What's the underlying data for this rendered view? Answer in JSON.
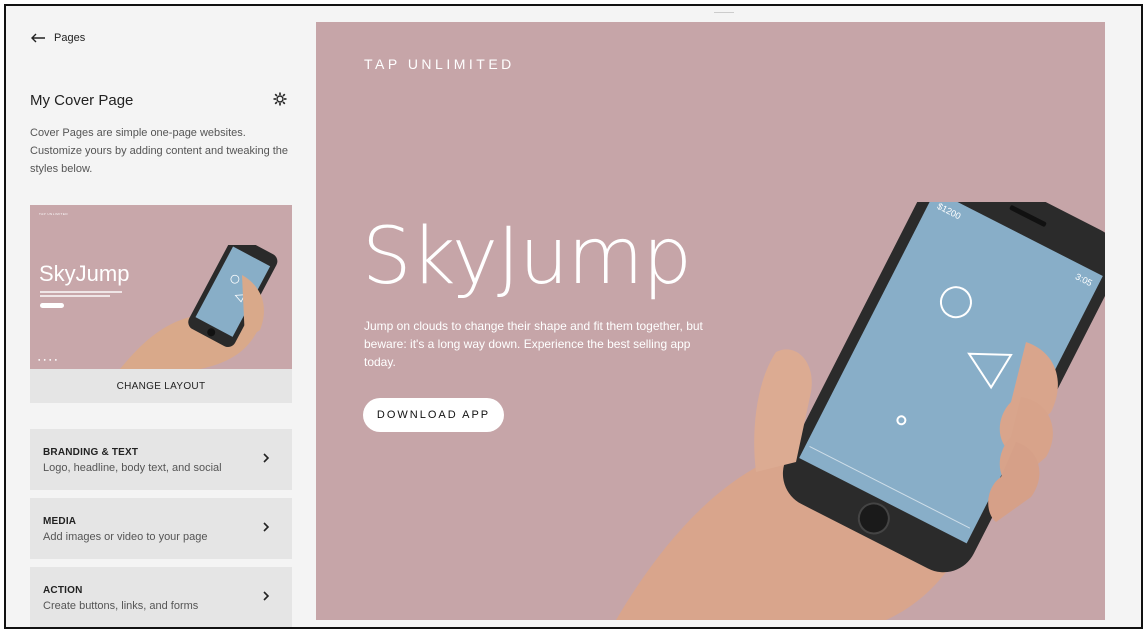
{
  "sidebar": {
    "back_label": "Pages",
    "page_title": "My Cover Page",
    "description": "Cover Pages are simple one-page websites. Customize yours by adding content and tweaking the styles below.",
    "thumbnail": {
      "brand": "TAP UNLIMITED",
      "headline": "SkyJump",
      "button": "DOWNLOAD APP"
    },
    "change_layout_label": "CHANGE LAYOUT",
    "panels": [
      {
        "title": "BRANDING & TEXT",
        "subtitle": "Logo, headline, body text, and social"
      },
      {
        "title": "MEDIA",
        "subtitle": "Add images or video to your page"
      },
      {
        "title": "ACTION",
        "subtitle": "Create buttons, links, and forms"
      }
    ]
  },
  "preview": {
    "brand": "TAP UNLIMITED",
    "headline": "SkyJump",
    "body": "Jump on clouds to change their shape and fit them together, but beware: it's a long way down. Experience the best selling app today.",
    "button_label": "DOWNLOAD APP",
    "phone_status_left": "$1200",
    "phone_status_right": "3:05",
    "background_color": "#c6a5a8"
  }
}
